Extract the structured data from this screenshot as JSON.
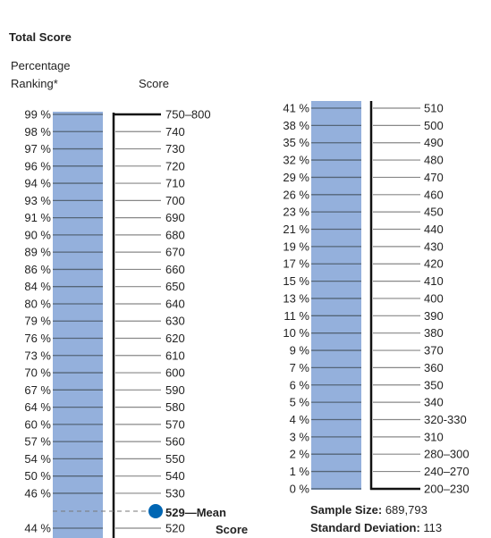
{
  "chart_data": {
    "type": "table",
    "title": "Total Score",
    "col_headers": [
      "Percentage Ranking*",
      "Score"
    ],
    "header_line1": "Percentage",
    "header_line2": "Ranking*",
    "score_header": "Score",
    "rows": [
      [
        "99 %",
        "750–800"
      ],
      [
        "98 %",
        "740"
      ],
      [
        "97 %",
        "730"
      ],
      [
        "96 %",
        "720"
      ],
      [
        "94 %",
        "710"
      ],
      [
        "93 %",
        "700"
      ],
      [
        "91 %",
        "690"
      ],
      [
        "90 %",
        "680"
      ],
      [
        "89 %",
        "670"
      ],
      [
        "86 %",
        "660"
      ],
      [
        "84 %",
        "650"
      ],
      [
        "80 %",
        "640"
      ],
      [
        "79 %",
        "630"
      ],
      [
        "76 %",
        "620"
      ],
      [
        "73 %",
        "610"
      ],
      [
        "70 %",
        "600"
      ],
      [
        "67 %",
        "590"
      ],
      [
        "64 %",
        "580"
      ],
      [
        "60 %",
        "570"
      ],
      [
        "57 %",
        "560"
      ],
      [
        "54 %",
        "550"
      ],
      [
        "50 %",
        "540"
      ],
      [
        "46 %",
        "530"
      ],
      [
        "44 %",
        "520"
      ],
      [
        "41 %",
        "510"
      ],
      [
        "38 %",
        "500"
      ],
      [
        "35 %",
        "490"
      ],
      [
        "32 %",
        "480"
      ],
      [
        "29 %",
        "470"
      ],
      [
        "26 %",
        "460"
      ],
      [
        "23 %",
        "450"
      ],
      [
        "21 %",
        "440"
      ],
      [
        "19 %",
        "430"
      ],
      [
        "17 %",
        "420"
      ],
      [
        "15 %",
        "410"
      ],
      [
        "13 %",
        "400"
      ],
      [
        "11 %",
        "390"
      ],
      [
        "10 %",
        "380"
      ],
      [
        "9 %",
        "370"
      ],
      [
        "7 %",
        "360"
      ],
      [
        "6 %",
        "350"
      ],
      [
        "5 %",
        "340"
      ],
      [
        "4 %",
        "320-330"
      ],
      [
        "3 %",
        "310"
      ],
      [
        "2 %",
        "280–300"
      ],
      [
        "1 %",
        "240–270"
      ],
      [
        "0 %",
        "200–230"
      ]
    ],
    "mean": {
      "value": 529,
      "label1": "529—Mean",
      "label2": "Score"
    },
    "sample_size_label": "Sample Size:",
    "sample_size": "689,793",
    "std_dev_label": "Standard Deviation:",
    "std_dev": "113",
    "colors": {
      "bar": "#94b0dc",
      "mean": "#0066b3",
      "axis": "#111111"
    }
  }
}
